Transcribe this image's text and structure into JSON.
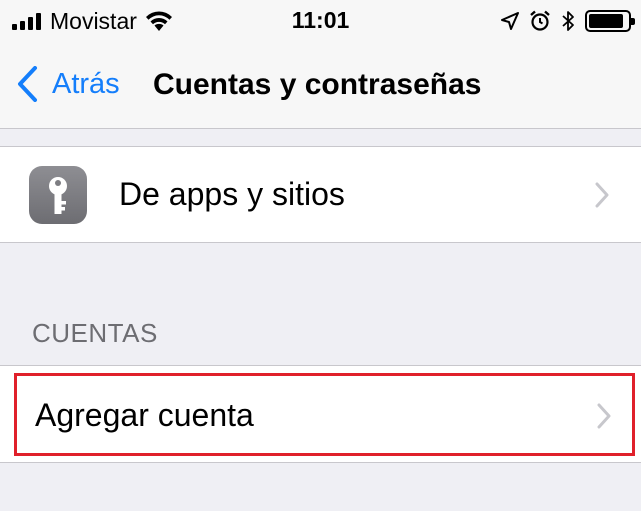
{
  "status_bar": {
    "carrier": "Movistar",
    "time": "11:01",
    "signal_bars": 4,
    "battery_level": 0.9,
    "icons": [
      "signal-icon",
      "wifi-icon",
      "location-icon",
      "alarm-icon",
      "bluetooth-icon",
      "battery-icon"
    ]
  },
  "nav": {
    "back_label": "Atrás",
    "title": "Cuentas y contraseñas"
  },
  "groups": {
    "passwords": {
      "label": "De apps y sitios",
      "icon": "key-icon"
    },
    "accounts": {
      "header": "CUENTAS",
      "add_label": "Agregar cuenta"
    }
  },
  "colors": {
    "accent": "#147efb",
    "background": "#efeff4",
    "highlight": "#e0202a",
    "section_header": "#6d6d72"
  }
}
